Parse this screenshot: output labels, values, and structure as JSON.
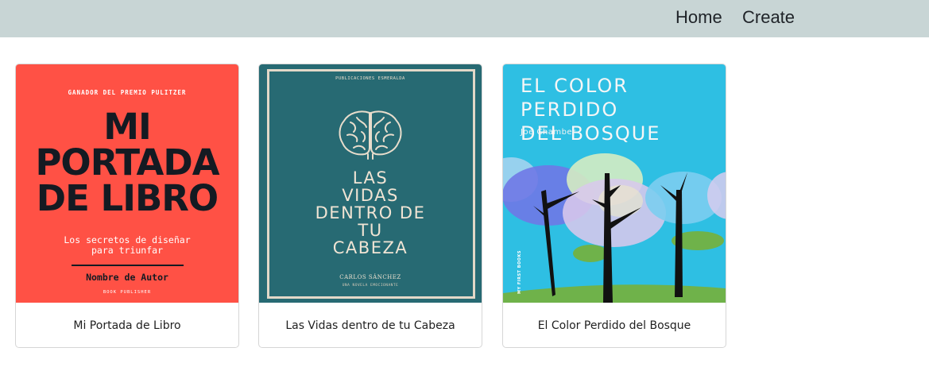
{
  "nav": {
    "home": "Home",
    "create": "Create"
  },
  "books": [
    {
      "caption": "Mi Portada de Libro",
      "cover": {
        "award": "GANADOR DEL PREMIO PULITZER",
        "title_lines": [
          "MI",
          "PORTADA",
          "DE LIBRO"
        ],
        "subtitle_lines": [
          "Los secretos de diseñar",
          "para triunfar"
        ],
        "author": "Nombre de Autor",
        "publisher": "BOOK PUBLISHER"
      }
    },
    {
      "caption": "Las Vidas dentro de tu Cabeza",
      "cover": {
        "publisher": "PUBLICACIONES ESMERALDA",
        "title_lines": [
          "LAS",
          "VIDAS",
          "DENTRO DE",
          "TU",
          "CABEZA"
        ],
        "author": "CARLOS SÁNCHEZ",
        "tagline": "UNA NOVELA EMOCIONANTE"
      }
    },
    {
      "caption": "El Color Perdido del Bosque",
      "cover": {
        "title_lines": [
          "EL COLOR PERDIDO",
          "DEL BOSQUE"
        ],
        "author": "Joe Chamber",
        "publisher_logo": "MY FIRST BOOKS"
      }
    }
  ],
  "colors": {
    "navbar_bg": "#c8d5d5",
    "cover1_bg": "#ff5145",
    "cover2_bg": "#276a73",
    "cover3_bg": "#2ebfe3"
  }
}
